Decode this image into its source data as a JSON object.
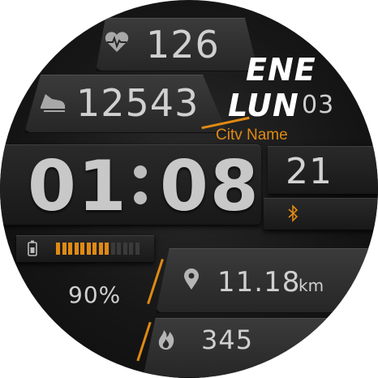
{
  "colors": {
    "accent": "#e08a14",
    "text": "#d0d0d0",
    "background": "#161616"
  },
  "icons": {
    "heart": "heart-rate-icon",
    "steps": "shoe-steps-icon",
    "bluetooth": "bluetooth-icon",
    "battery": "battery-icon",
    "location": "location-pin-icon",
    "calories": "flame-icon"
  },
  "heart_rate": {
    "value": "126"
  },
  "steps": {
    "value": "12543"
  },
  "date": {
    "month": "ENE",
    "weekday": "LUN",
    "day": "03"
  },
  "location": {
    "city": "Citv Name"
  },
  "time": {
    "hours": "01",
    "minutes": "08",
    "seconds": "21"
  },
  "battery": {
    "percent_text": "90%",
    "level_fraction": 0.9,
    "segments_total": 14,
    "segments_filled": 9
  },
  "distance": {
    "value": "11.18",
    "unit": "km"
  },
  "calories": {
    "value": "345"
  }
}
